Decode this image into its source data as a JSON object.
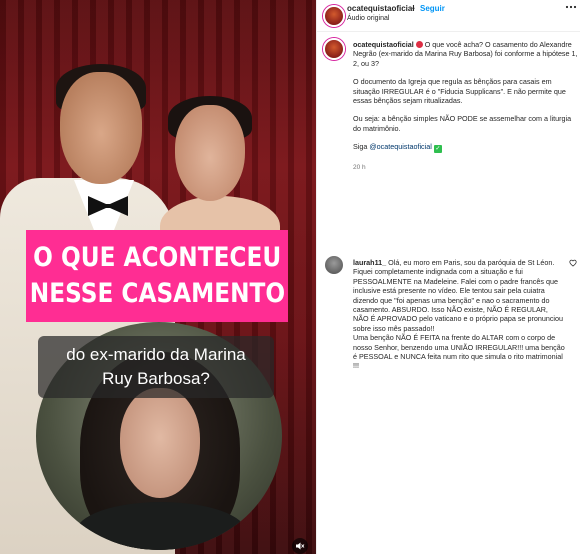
{
  "video": {
    "banner_lines": [
      "O QUE ACONTECEU",
      "NESSE CASAMENTO"
    ],
    "caption_lines": [
      "do ex-marido da Marina",
      "Ruy Barbosa?"
    ],
    "mute_icon": "speaker-muted-icon"
  },
  "header": {
    "username": "ocatequistaoficial",
    "separator": "•",
    "follow_label": "Seguir",
    "audio_label": "Áudio original",
    "more_icon": "more-horizontal-icon"
  },
  "post": {
    "username": "ocatequistaoficial",
    "intro": "O que você acha? O casamento do Alexandre Negrão (ex-marido da Marina Ruy Barbosa) foi conforme a hipótese 1, 2, ou 3?",
    "paragraph2": "O documento da Igreja que regula as bênçãos para casais em situação IRREGULAR é o \"Fiducia Supplicans\". E não permite que essas bênçãos sejam ritualizadas.",
    "paragraph3": "Ou seja: a bênção simples NÃO PODE se assemelhar com a liturgia do matrimônio.",
    "follow_prefix": "Siga",
    "follow_handle": "@ocatequistaoficial",
    "time": "20 h"
  },
  "comment": {
    "username": "laurah11_",
    "text1": "Olá, eu moro em Paris, sou da paróquia de St Léon. Fiquei completamente indignada com a situação e fui PESSOALMENTE na Madeleine. Falei com o padre francês que inclusive está presente no vídeo. Ele tentou sair pela cuiatra dizendo que \"foi apenas uma benção\" e nao o sacramento do casamento. ABSURDO. Isso NÃO existe, NÃO É REGULAR, NÃO É APROVADO pelo vaticano e o próprio papa se pronunciou sobre isso mês passado!!",
    "text2": "Uma benção NÃO É FEITA na frente do ALTAR com o corpo de nosso Senhor, benzendo uma UNIÃO IRREGULAR!!! uma benção é PESSOAL e NUNCA feita num rito que simula o rito matrimonial !!!"
  }
}
